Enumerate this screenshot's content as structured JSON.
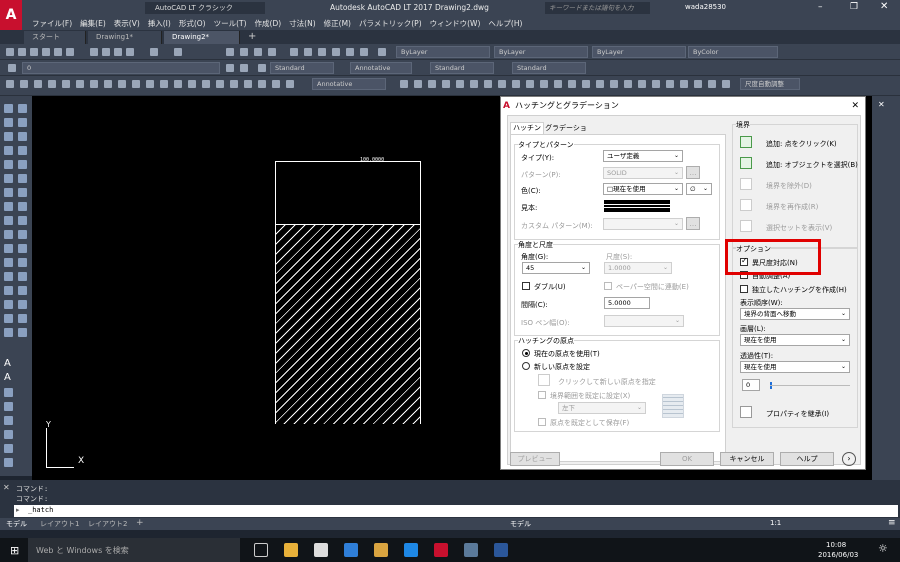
{
  "titlebar": {
    "workspace": "AutoCAD LT クラシック",
    "title": "Autodesk AutoCAD LT 2017   Drawing2.dwg",
    "search_placeholder": "キーワードまたは語句を入力",
    "user": "wada28530"
  },
  "menu": [
    "ファイル(F)",
    "編集(E)",
    "表示(V)",
    "挿入(I)",
    "形式(O)",
    "ツール(T)",
    "作成(D)",
    "寸法(N)",
    "修正(M)",
    "パラメトリック(P)",
    "ウィンドウ(W)",
    "ヘルプ(H)"
  ],
  "tabs": [
    "スタート",
    "Drawing1*",
    "Drawing2*"
  ],
  "toolbar2": {
    "layer1": "ByLayer",
    "layer2": "ByLayer",
    "layer3": "ByLayer",
    "color": "ByColor"
  },
  "toolbar3": {
    "layer_value": "0",
    "textstyle": "Standard",
    "annotative": "Annotative",
    "dimstyle": "Standard",
    "tablestyle": "Standard"
  },
  "toolbar4": {
    "annotative": "Annotative",
    "scale": "尺度自動調整"
  },
  "canvas": {
    "dimension_text": "100.0000",
    "ucs_y": "Y",
    "ucs_x": "X"
  },
  "dialog": {
    "title": "ハッチングとグラデーション",
    "tab_hatch": "ハッチング",
    "tab_gradient": "グラデーション",
    "type_pattern_header": "タイプとパターン",
    "type_label": "タイプ(Y):",
    "type_value": "ユーザ定義",
    "pattern_label": "パターン(P):",
    "pattern_value": "SOLID",
    "color_label": "色(C):",
    "color_value": "□現在を使用",
    "color_value2": "∅",
    "sample_label": "見本:",
    "custom_pattern_label": "カスタム パターン(M):",
    "angle_scale_header": "角度と尺度",
    "angle_label": "角度(G):",
    "angle_value": "45",
    "scale_label": "尺度(S):",
    "scale_value": "1.0000",
    "double_label": "ダブル(U)",
    "paperspace_label": "ペーパー空間に連動(E)",
    "spacing_label": "間隔(C):",
    "spacing_value": "5.0000",
    "iso_label": "ISO ペン幅(O):",
    "origin_header": "ハッチングの原点",
    "origin_current": "現在の原点を使用(T)",
    "origin_new": "新しい原点を設定",
    "origin_click": "クリックして新しい原点を指定",
    "origin_default_boundary": "境界範囲を既定に設定(X)",
    "origin_position": "左下",
    "origin_store": "原点を既定として保存(F)",
    "boundary_header": "境界",
    "add_pick": "追加: 点をクリック(K)",
    "add_select": "追加: オブジェクトを選択(B)",
    "remove_boundary": "境界を除外(D)",
    "recreate_boundary": "境界を再作成(R)",
    "view_selection": "選択セットを表示(V)",
    "options_header": "オプション",
    "annotative_label": "異尺度対応(N)",
    "associative_label": "自動調整(A)",
    "separate_label": "独立したハッチングを作成(H)",
    "draw_order_label": "表示順序(W):",
    "draw_order_value": "境界の背面へ移動",
    "layer_label": "画層(L):",
    "layer_value": "現在を使用",
    "transparency_label": "透過性(T):",
    "transparency_value": "現在を使用",
    "transparency_number": "0",
    "inherit_label": "プロパティを継承(I)",
    "preview_button": "プレビュー",
    "ok_button": "OK",
    "cancel_button": "キャンセル",
    "help_button": "ヘルプ"
  },
  "command": {
    "line1": "コマンド:",
    "line2": "コマンド:",
    "input": "_hatch"
  },
  "layout_tabs": [
    "モデル",
    "レイアウト1",
    "レイアウト2"
  ],
  "status": {
    "model": "モデル",
    "scale": "1:1"
  },
  "taskbar": {
    "search": "Web と Windows を検索",
    "time": "10:08",
    "date": "2016/06/03"
  },
  "colors": {
    "highlight_box": "#e00000",
    "autocad_red": "#c8102e"
  }
}
